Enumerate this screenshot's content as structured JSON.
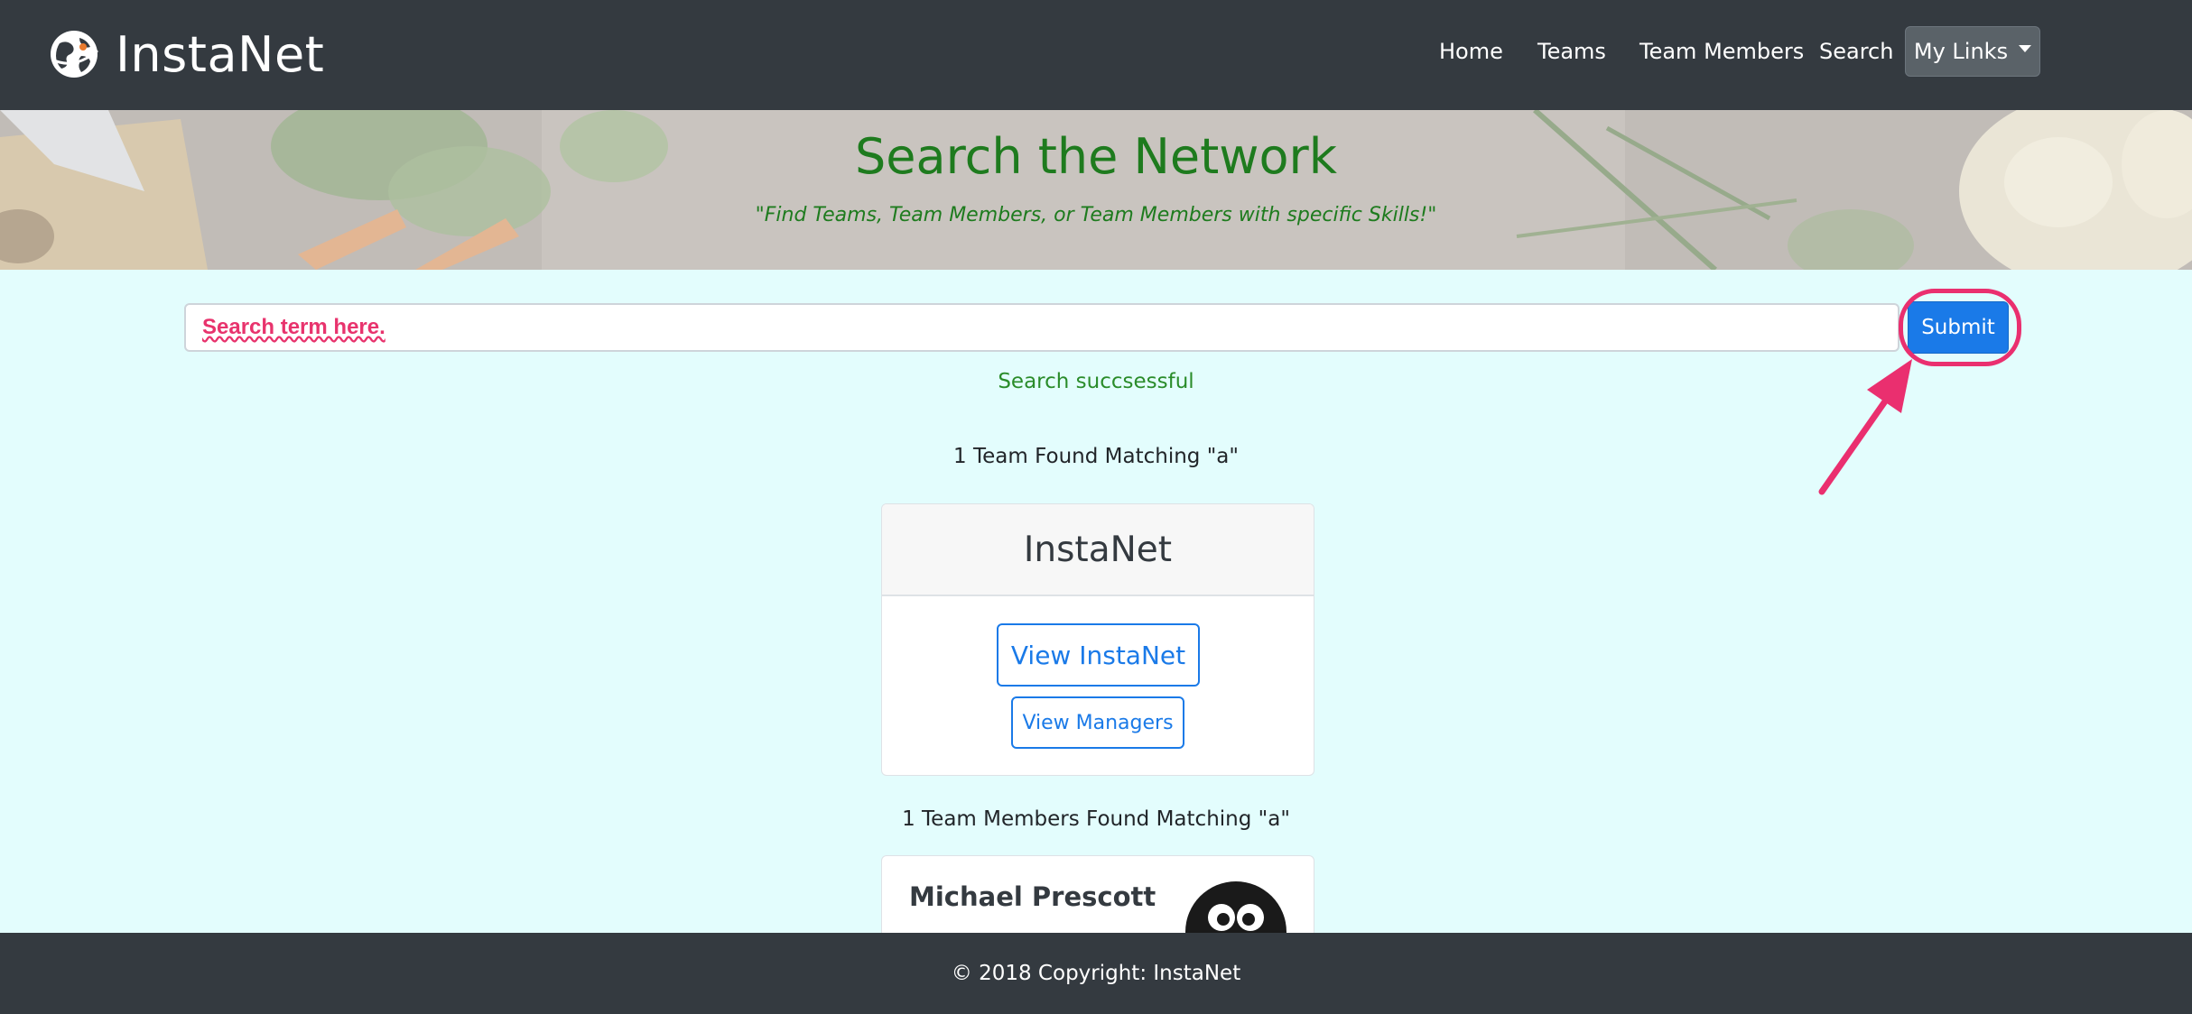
{
  "navbar": {
    "brand": "InstaNet",
    "links": [
      "Home",
      "Teams",
      "Team Members",
      "Search"
    ],
    "dropdown_label": "My Links"
  },
  "hero": {
    "title": "Search the Network",
    "subtitle": "\"Find Teams, Team Members, or Team Members with specific Skills!\""
  },
  "search": {
    "input_value": "Search term here.",
    "submit_label": "Submit",
    "status": "Search succsessful"
  },
  "teams": {
    "heading": "1 Team Found Matching \"a\"",
    "items": [
      {
        "name": "InstaNet",
        "view_label": "View InstaNet",
        "managers_label": "View Managers"
      }
    ]
  },
  "members": {
    "heading": "1 Team Members Found Matching \"a\"",
    "items": [
      {
        "name": "Michael Prescott"
      }
    ]
  },
  "footer": {
    "text": "© 2018 Copyright: InstaNet"
  },
  "colors": {
    "navbar_bg": "#343a40",
    "page_bg": "#e3fdfd",
    "hero_title": "#1e7b1e",
    "primary": "#1a7ae8",
    "annotation": "#ea2f6f"
  }
}
